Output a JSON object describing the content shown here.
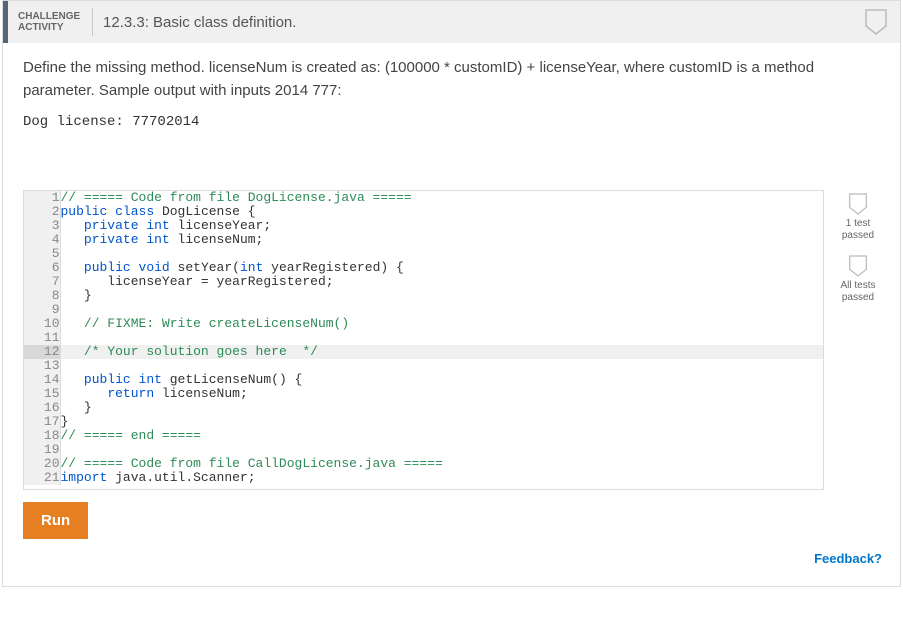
{
  "header": {
    "label_line1": "CHALLENGE",
    "label_line2": "ACTIVITY",
    "title": "12.3.3: Basic class definition."
  },
  "problem": {
    "description": "Define the missing method. licenseNum is created as: (100000 * customID) + licenseYear, where customID is a method parameter. Sample output with inputs 2014 777:",
    "sample_output": "Dog license: 77702014"
  },
  "code": {
    "highlighted_line": 12,
    "lines": [
      {
        "n": 1,
        "tokens": [
          {
            "t": "// ===== Code from file DogLicense.java =====",
            "c": "comment"
          }
        ]
      },
      {
        "n": 2,
        "tokens": [
          {
            "t": "public",
            "c": "keyword"
          },
          {
            "t": " "
          },
          {
            "t": "class",
            "c": "keyword"
          },
          {
            "t": " DogLicense {",
            "c": "ident"
          }
        ]
      },
      {
        "n": 3,
        "tokens": [
          {
            "t": "   "
          },
          {
            "t": "private",
            "c": "keyword"
          },
          {
            "t": " "
          },
          {
            "t": "int",
            "c": "type"
          },
          {
            "t": " licenseYear;",
            "c": "ident"
          }
        ]
      },
      {
        "n": 4,
        "tokens": [
          {
            "t": "   "
          },
          {
            "t": "private",
            "c": "keyword"
          },
          {
            "t": " "
          },
          {
            "t": "int",
            "c": "type"
          },
          {
            "t": " licenseNum;",
            "c": "ident"
          }
        ]
      },
      {
        "n": 5,
        "tokens": [
          {
            "t": ""
          }
        ]
      },
      {
        "n": 6,
        "tokens": [
          {
            "t": "   "
          },
          {
            "t": "public",
            "c": "keyword"
          },
          {
            "t": " "
          },
          {
            "t": "void",
            "c": "type"
          },
          {
            "t": " setYear(",
            "c": "ident"
          },
          {
            "t": "int",
            "c": "type"
          },
          {
            "t": " yearRegistered) {",
            "c": "ident"
          }
        ]
      },
      {
        "n": 7,
        "tokens": [
          {
            "t": "      licenseYear = yearRegistered;",
            "c": "ident"
          }
        ]
      },
      {
        "n": 8,
        "tokens": [
          {
            "t": "   }",
            "c": "ident"
          }
        ]
      },
      {
        "n": 9,
        "tokens": [
          {
            "t": ""
          }
        ]
      },
      {
        "n": 10,
        "tokens": [
          {
            "t": "   "
          },
          {
            "t": "// FIXME: Write createLicenseNum()",
            "c": "comment"
          }
        ]
      },
      {
        "n": 11,
        "tokens": [
          {
            "t": ""
          }
        ]
      },
      {
        "n": 12,
        "tokens": [
          {
            "t": "   "
          },
          {
            "t": "/* Your solution goes here  */",
            "c": "comment"
          }
        ]
      },
      {
        "n": 13,
        "tokens": [
          {
            "t": ""
          }
        ]
      },
      {
        "n": 14,
        "tokens": [
          {
            "t": "   "
          },
          {
            "t": "public",
            "c": "keyword"
          },
          {
            "t": " "
          },
          {
            "t": "int",
            "c": "type"
          },
          {
            "t": " getLicenseNum() {",
            "c": "ident"
          }
        ]
      },
      {
        "n": 15,
        "tokens": [
          {
            "t": "      "
          },
          {
            "t": "return",
            "c": "keyword"
          },
          {
            "t": " licenseNum;",
            "c": "ident"
          }
        ]
      },
      {
        "n": 16,
        "tokens": [
          {
            "t": "   }",
            "c": "ident"
          }
        ]
      },
      {
        "n": 17,
        "tokens": [
          {
            "t": "}",
            "c": "ident"
          }
        ]
      },
      {
        "n": 18,
        "tokens": [
          {
            "t": "// ===== end =====",
            "c": "comment"
          }
        ]
      },
      {
        "n": 19,
        "tokens": [
          {
            "t": ""
          }
        ]
      },
      {
        "n": 20,
        "tokens": [
          {
            "t": "// ===== Code from file CallDogLicense.java =====",
            "c": "comment"
          }
        ]
      },
      {
        "n": 21,
        "tokens": [
          {
            "t": "import",
            "c": "keyword"
          },
          {
            "t": " java.util.Scanner;",
            "c": "ident"
          }
        ]
      }
    ]
  },
  "status": {
    "one_test": "1 test passed",
    "all_tests": "All tests passed"
  },
  "controls": {
    "run_label": "Run"
  },
  "footer": {
    "feedback_label": "Feedback?"
  }
}
